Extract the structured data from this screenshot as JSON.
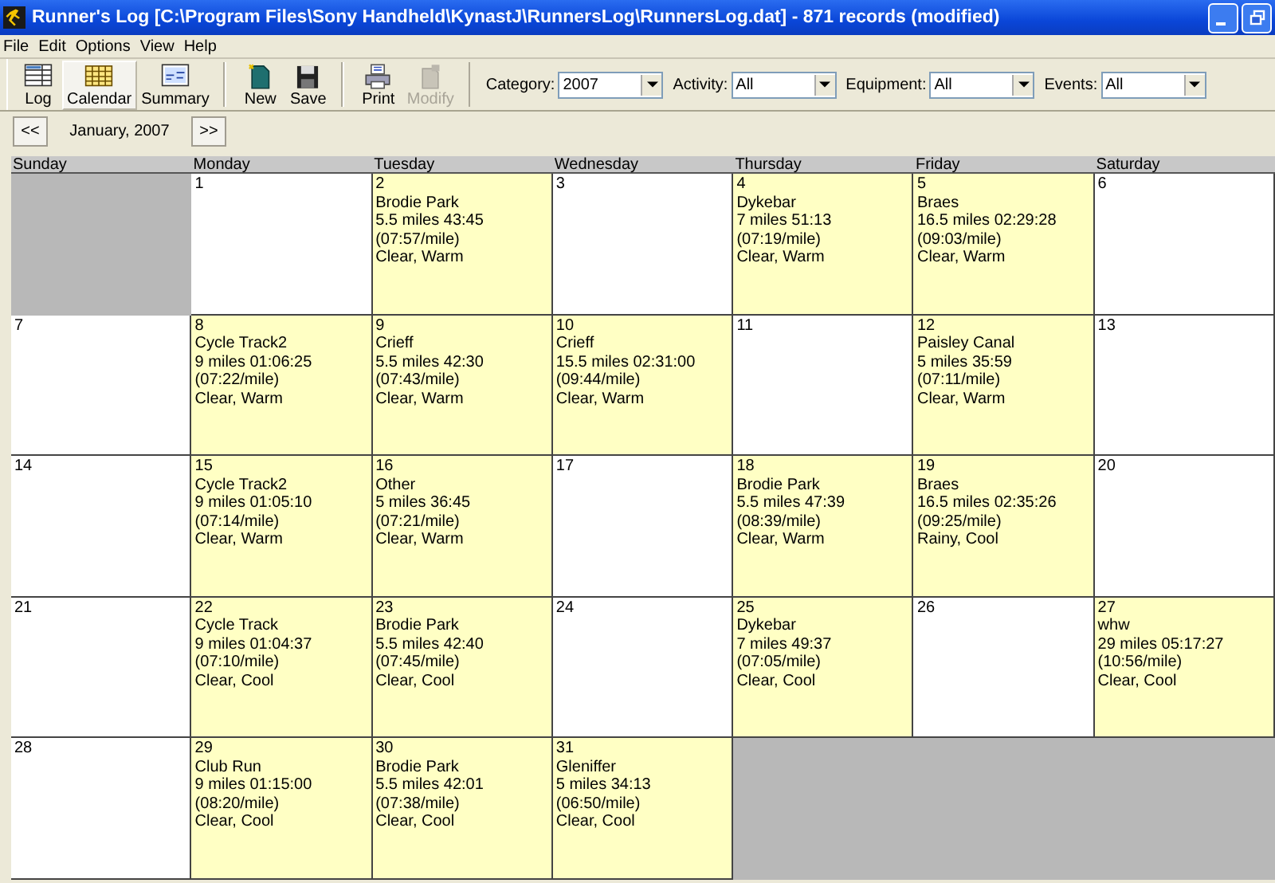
{
  "window": {
    "title": "Runner's Log [C:\\Program Files\\Sony Handheld\\KynastJ\\RunnersLog\\RunnersLog.dat] - 871 records (modified)"
  },
  "menu": [
    "File",
    "Edit",
    "Options",
    "View",
    "Help"
  ],
  "toolbar": [
    {
      "label": "Log",
      "kind": "log",
      "selected": false,
      "disabled": false
    },
    {
      "label": "Calendar",
      "kind": "calendar",
      "selected": true,
      "disabled": false
    },
    {
      "label": "Summary",
      "kind": "summary",
      "selected": false,
      "disabled": false
    },
    {
      "kind": "separator"
    },
    {
      "label": "New",
      "kind": "new",
      "selected": false,
      "disabled": false
    },
    {
      "label": "Save",
      "kind": "save",
      "selected": false,
      "disabled": false
    },
    {
      "kind": "separator"
    },
    {
      "label": "Print",
      "kind": "print",
      "selected": false,
      "disabled": false
    },
    {
      "label": "Modify",
      "kind": "modify",
      "selected": false,
      "disabled": true
    }
  ],
  "filters": [
    {
      "label": "Category:",
      "value": "2007"
    },
    {
      "label": "Activity:",
      "value": "All"
    },
    {
      "label": "Equipment:",
      "value": "All"
    },
    {
      "label": "Events:",
      "value": "All"
    }
  ],
  "nav": {
    "prev": "<<",
    "month": "January, 2007",
    "next": ">>"
  },
  "weekdays": [
    "Sunday",
    "Monday",
    "Tuesday",
    "Wednesday",
    "Thursday",
    "Friday",
    "Saturday"
  ],
  "weeks": [
    [
      {
        "kind": "blank"
      },
      {
        "kind": "day",
        "day": "1"
      },
      {
        "kind": "day",
        "day": "2",
        "lines": [
          "Brodie Park",
          "5.5 miles 43:45",
          "(07:57/mile)",
          "Clear, Warm"
        ]
      },
      {
        "kind": "day",
        "day": "3"
      },
      {
        "kind": "day",
        "day": "4",
        "lines": [
          "Dykebar",
          "7 miles 51:13",
          "(07:19/mile)",
          "Clear, Warm"
        ]
      },
      {
        "kind": "day",
        "day": "5",
        "lines": [
          "Braes",
          "16.5 miles 02:29:28",
          "(09:03/mile)",
          "Clear, Warm"
        ]
      },
      {
        "kind": "day",
        "day": "6"
      }
    ],
    [
      {
        "kind": "day",
        "day": "7"
      },
      {
        "kind": "day",
        "day": "8",
        "lines": [
          "Cycle Track2",
          "9 miles 01:06:25",
          "(07:22/mile)",
          "Clear, Warm"
        ]
      },
      {
        "kind": "day",
        "day": "9",
        "lines": [
          "Crieff",
          "5.5 miles 42:30",
          "(07:43/mile)",
          "Clear, Warm"
        ]
      },
      {
        "kind": "day",
        "day": "10",
        "lines": [
          "Crieff",
          "15.5 miles 02:31:00",
          "(09:44/mile)",
          "Clear, Warm"
        ]
      },
      {
        "kind": "day",
        "day": "11"
      },
      {
        "kind": "day",
        "day": "12",
        "lines": [
          "Paisley Canal",
          "5 miles 35:59",
          "(07:11/mile)",
          "Clear, Warm"
        ]
      },
      {
        "kind": "day",
        "day": "13"
      }
    ],
    [
      {
        "kind": "day",
        "day": "14"
      },
      {
        "kind": "day",
        "day": "15",
        "lines": [
          "Cycle Track2",
          "9 miles 01:05:10",
          "(07:14/mile)",
          "Clear, Warm"
        ]
      },
      {
        "kind": "day",
        "day": "16",
        "lines": [
          "Other",
          "5 miles 36:45",
          "(07:21/mile)",
          "Clear, Warm"
        ]
      },
      {
        "kind": "day",
        "day": "17"
      },
      {
        "kind": "day",
        "day": "18",
        "lines": [
          "Brodie Park",
          "5.5 miles 47:39",
          "(08:39/mile)",
          "Clear, Warm"
        ]
      },
      {
        "kind": "day",
        "day": "19",
        "lines": [
          "Braes",
          "16.5 miles 02:35:26",
          "(09:25/mile)",
          "Rainy, Cool"
        ]
      },
      {
        "kind": "day",
        "day": "20"
      }
    ],
    [
      {
        "kind": "day",
        "day": "21"
      },
      {
        "kind": "day",
        "day": "22",
        "lines": [
          "Cycle Track",
          "9 miles 01:04:37",
          "(07:10/mile)",
          "Clear, Cool"
        ]
      },
      {
        "kind": "day",
        "day": "23",
        "lines": [
          "Brodie Park",
          "5.5 miles 42:40",
          "(07:45/mile)",
          "Clear, Cool"
        ]
      },
      {
        "kind": "day",
        "day": "24"
      },
      {
        "kind": "day",
        "day": "25",
        "lines": [
          "Dykebar",
          "7 miles 49:37",
          "(07:05/mile)",
          "Clear, Cool"
        ]
      },
      {
        "kind": "day",
        "day": "26"
      },
      {
        "kind": "day",
        "day": "27",
        "lines": [
          "whw",
          "29 miles 05:17:27",
          "(10:56/mile)",
          "Clear, Cool"
        ]
      }
    ],
    [
      {
        "kind": "day",
        "day": "28"
      },
      {
        "kind": "day",
        "day": "29",
        "lines": [
          "Club Run",
          "9 miles 01:15:00",
          "(08:20/mile)",
          "Clear, Cool"
        ]
      },
      {
        "kind": "day",
        "day": "30",
        "lines": [
          "Brodie Park",
          "5.5 miles 42:01",
          "(07:38/mile)",
          "Clear, Cool"
        ]
      },
      {
        "kind": "day",
        "day": "31",
        "lines": [
          "Gleniffer",
          "5 miles 34:13",
          "(06:50/mile)",
          "Clear, Cool"
        ]
      },
      {
        "kind": "blank"
      },
      {
        "kind": "blank"
      },
      {
        "kind": "blank"
      }
    ]
  ]
}
